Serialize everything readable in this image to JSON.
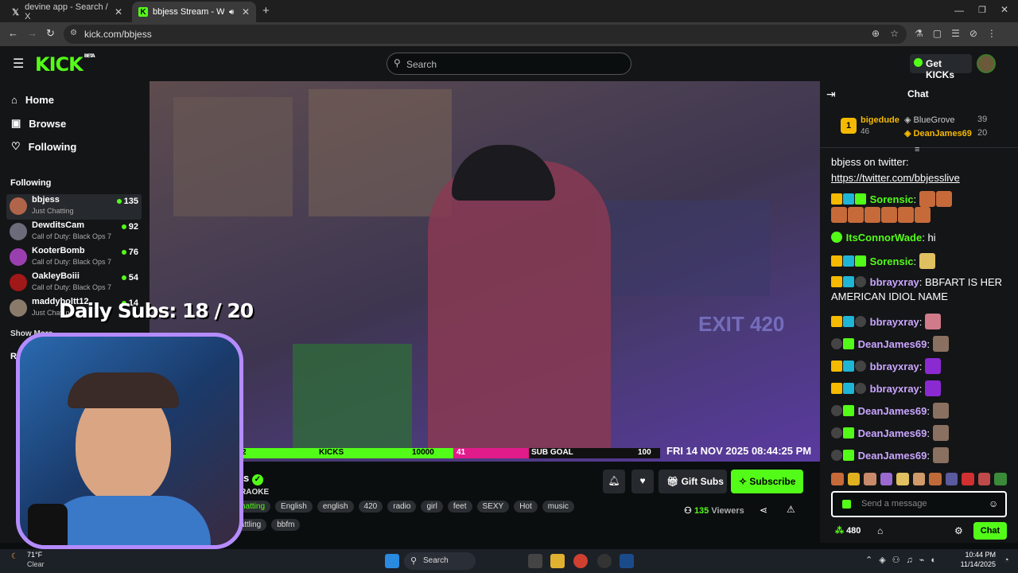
{
  "browser": {
    "tabs": [
      {
        "title": "devine app - Search / X",
        "active": false
      },
      {
        "title": "bbjess Stream - Watch Live",
        "active": true
      }
    ],
    "url": "kick.com/bbjess"
  },
  "header": {
    "logo": "KICK",
    "logo_sup": "BETA",
    "search_placeholder": "Search",
    "get_kicks_label": "Get KICKs"
  },
  "sidebar": {
    "nav": [
      {
        "label": "Home",
        "icon": "home-icon"
      },
      {
        "label": "Browse",
        "icon": "browse-icon"
      },
      {
        "label": "Following",
        "icon": "heart-icon"
      }
    ],
    "following_title": "Following",
    "following": [
      {
        "name": "bbjess",
        "category": "Just Chatting",
        "viewers": "135"
      },
      {
        "name": "DewditsCam",
        "category": "Call of Duty: Black Ops 7",
        "viewers": "92"
      },
      {
        "name": "KooterBomb",
        "category": "Call of Duty: Black Ops 7",
        "viewers": "76"
      },
      {
        "name": "OakleyBoiii",
        "category": "Call of Duty: Black Ops 7",
        "viewers": "54"
      },
      {
        "name": "maddyboltt12",
        "category": "Just Chatting",
        "viewers": "14"
      }
    ],
    "show_more": "Show More",
    "recommended_title": "Recom"
  },
  "overlay": {
    "daily_subs": "Daily Subs: 18 / 20",
    "goal_bar": {
      "left": "2",
      "kicks_label": "KICKS",
      "kicks_value": "10000",
      "sub_value": "41",
      "sub_goal_label": "SUB GOAL",
      "sub_goal_max": "100"
    },
    "timestamp": "FRI 14 NOV 2025 08:44:25 PM"
  },
  "stream": {
    "title_partial": "s",
    "category_partial": "RAOKE",
    "tags": [
      "hatting",
      "English",
      "english",
      "420",
      "radio",
      "girl",
      "feet",
      "SEXY",
      "Hot",
      "music"
    ],
    "tags_row2": [
      "chattling",
      "bbfm"
    ],
    "gift_subs_label": "Gift Subs",
    "subscribe_label": "Subscribe",
    "viewers": "135",
    "viewers_label": "Viewers"
  },
  "chat": {
    "title": "Chat",
    "leaderboard": [
      {
        "rank": "1",
        "name": "bigedude",
        "count": "46"
      },
      {
        "name": "BlueGrove",
        "count": "39"
      },
      {
        "name": "DeanJames69",
        "count": "20"
      }
    ],
    "pinned_text": "bbjess on twitter:",
    "pinned_link": "https://twitter.com/bbjesslive",
    "messages": [
      {
        "user": "Sorensic",
        "color": "#53fc18",
        "text": ""
      },
      {
        "user": "ItsConnorWade",
        "color": "#53fc18",
        "text": "hi"
      },
      {
        "user": "Sorensic",
        "color": "#53fc18",
        "text": ""
      },
      {
        "user": "bbrayxray",
        "color": "#c9a6ff",
        "text": "BBFART IS HER AMERICAN IDIOL NAME"
      },
      {
        "user": "bbrayxray",
        "color": "#c9a6ff",
        "text": ""
      },
      {
        "user": "DeanJames69",
        "color": "#c9a6ff",
        "text": ""
      },
      {
        "user": "bbrayxray",
        "color": "#c9a6ff",
        "text": ""
      },
      {
        "user": "bbrayxray",
        "color": "#c9a6ff",
        "text": ""
      },
      {
        "user": "DeanJames69",
        "color": "#c9a6ff",
        "text": ""
      },
      {
        "user": "DeanJames69",
        "color": "#c9a6ff",
        "text": ""
      },
      {
        "user": "DeanJames69",
        "color": "#c9a6ff",
        "text": ""
      }
    ],
    "input_placeholder": "Send a message",
    "kicks_balance": "480",
    "send_label": "Chat"
  },
  "taskbar": {
    "weather_temp": "71°F",
    "weather_desc": "Clear",
    "search_label": "Search",
    "time": "10:44 PM",
    "date": "11/14/2025"
  },
  "colors": {
    "accent": "#53fc18",
    "background": "#0b0e0f",
    "panel": "#141517",
    "goal_pink": "#e11b8a"
  }
}
